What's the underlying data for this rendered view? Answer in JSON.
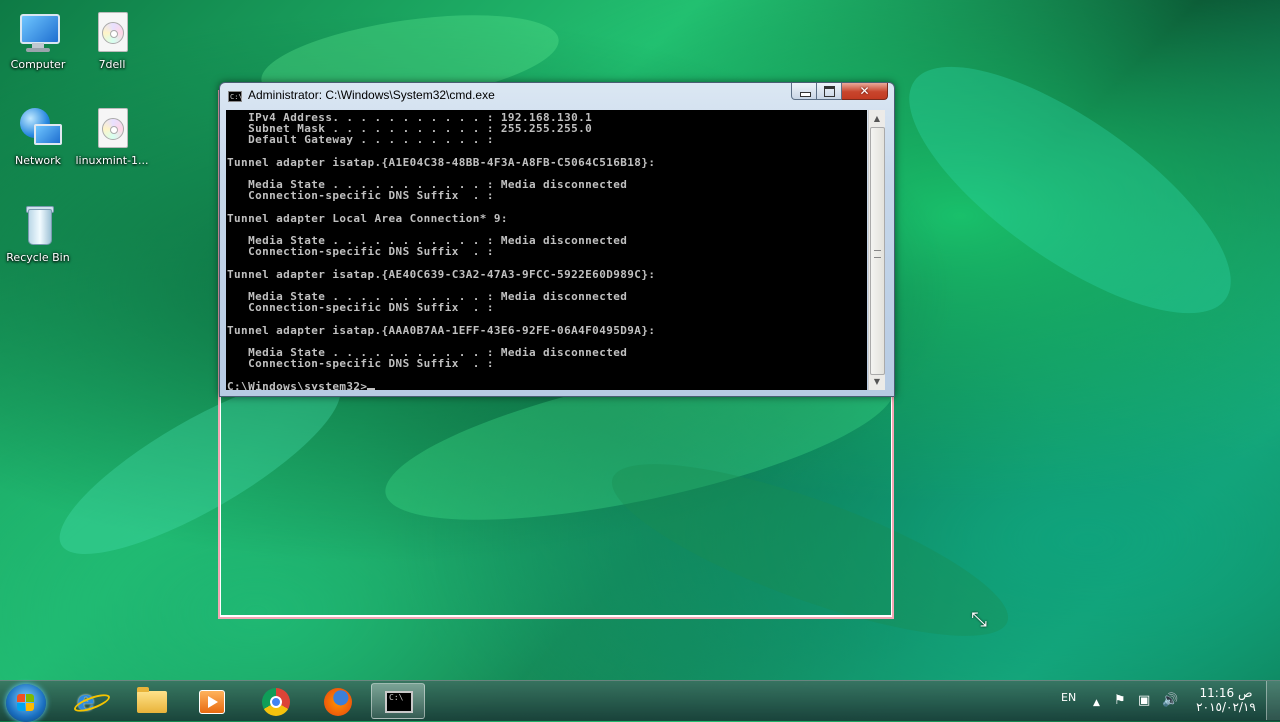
{
  "desktop": {
    "icons": [
      {
        "label": "Computer",
        "icon": "computer-icon"
      },
      {
        "label": "7dell",
        "icon": "disc-image-icon"
      },
      {
        "label": "Network",
        "icon": "network-icon"
      },
      {
        "label": "linuxmint-1...",
        "icon": "disc-image-icon"
      },
      {
        "label": "Recycle Bin",
        "icon": "recycle-bin-icon"
      }
    ]
  },
  "cmd": {
    "title": "Administrator: C:\\Windows\\System32\\cmd.exe",
    "output_lines": [
      "   IPv4 Address. . . . . . . . . . . : 192.168.130.1",
      "   Subnet Mask . . . . . . . . . . . : 255.255.255.0",
      "   Default Gateway . . . . . . . . . :",
      "",
      "Tunnel adapter isatap.{A1E04C38-48BB-4F3A-A8FB-C5064C516B18}:",
      "",
      "   Media State . . . . . . . . . . . : Media disconnected",
      "   Connection-specific DNS Suffix  . :",
      "",
      "Tunnel adapter Local Area Connection* 9:",
      "",
      "   Media State . . . . . . . . . . . : Media disconnected",
      "   Connection-specific DNS Suffix  . :",
      "",
      "Tunnel adapter isatap.{AE40C639-C3A2-47A3-9FCC-5922E60D989C}:",
      "",
      "   Media State . . . . . . . . . . . : Media disconnected",
      "   Connection-specific DNS Suffix  . :",
      "",
      "Tunnel adapter isatap.{AAA0B7AA-1EFF-43E6-92FE-06A4F0495D9A}:",
      "",
      "   Media State . . . . . . . . . . . : Media disconnected",
      "   Connection-specific DNS Suffix  . :",
      ""
    ],
    "prompt": "C:\\Windows\\system32>",
    "title_icon_text": "C:\\"
  },
  "taskbar": {
    "apps": [
      {
        "name": "Internet Explorer",
        "icon": "internet-explorer-icon"
      },
      {
        "name": "Windows Explorer",
        "icon": "folder-icon"
      },
      {
        "name": "Windows Media Player",
        "icon": "media-player-icon"
      },
      {
        "name": "Google Chrome",
        "icon": "chrome-icon"
      },
      {
        "name": "Mozilla Firefox",
        "icon": "firefox-icon"
      },
      {
        "name": "Command Prompt",
        "icon": "cmd-icon",
        "active": true
      }
    ],
    "cmd_icon_text": "C:\\",
    "language": "EN",
    "clock_time": "11:16 ص",
    "clock_date": "٢٠١٥/٠٢/١٩"
  },
  "colors": {
    "console_bg": "#000000",
    "console_fg": "#c0c0c0",
    "drag_frame": "#f3a6b4"
  }
}
